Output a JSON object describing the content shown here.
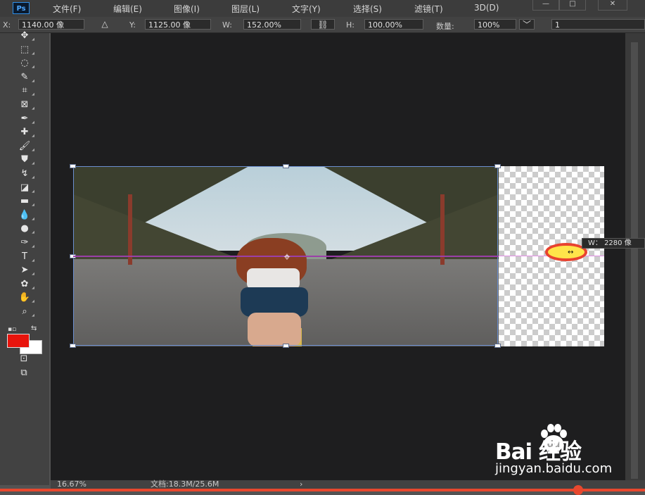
{
  "menubar": {
    "logo": "Ps",
    "items": [
      "文件(F)",
      "编辑(E)",
      "图像(I)",
      "图层(L)",
      "文字(Y)",
      "选择(S)",
      "滤镜(T)",
      "3D(D)"
    ],
    "window_controls": [
      "—",
      "□",
      "✕"
    ]
  },
  "options": {
    "x_label": "X:",
    "x_value": "1140.00 像",
    "y_label": "Y:",
    "y_value": "1125.00 像",
    "w_label": "W:",
    "w_value": "152.00%",
    "h_label": "H:",
    "h_value": "100.00%",
    "opacity_label": "数量:",
    "opacity_value": "100%",
    "last_value": "1",
    "dropdown_glyph": "﹀"
  },
  "tools": [
    {
      "name": "move-tool",
      "glyph": "✥"
    },
    {
      "name": "marquee-tool",
      "glyph": "⬚"
    },
    {
      "name": "lasso-tool",
      "glyph": "◌"
    },
    {
      "name": "quick-select-tool",
      "glyph": "✎"
    },
    {
      "name": "crop-tool",
      "glyph": "⌗"
    },
    {
      "name": "frame-tool",
      "glyph": "⊠"
    },
    {
      "name": "eyedropper-tool",
      "glyph": "✒"
    },
    {
      "name": "healing-tool",
      "glyph": "✚"
    },
    {
      "name": "brush-tool",
      "glyph": "🖌"
    },
    {
      "name": "stamp-tool",
      "glyph": "⛊"
    },
    {
      "name": "history-brush-tool",
      "glyph": "↯"
    },
    {
      "name": "eraser-tool",
      "glyph": "◪"
    },
    {
      "name": "gradient-tool",
      "glyph": "▬"
    },
    {
      "name": "blur-tool",
      "glyph": "💧"
    },
    {
      "name": "dodge-tool",
      "glyph": "●"
    },
    {
      "name": "pen-tool",
      "glyph": "✑"
    },
    {
      "name": "type-tool",
      "glyph": "T"
    },
    {
      "name": "path-select-tool",
      "glyph": "➤"
    },
    {
      "name": "shape-tool",
      "glyph": "✿"
    },
    {
      "name": "hand-tool",
      "glyph": "✋"
    },
    {
      "name": "zoom-tool",
      "glyph": "⌕"
    }
  ],
  "colors": {
    "foreground": "#e8140c",
    "background": "#ffffff",
    "accent": "#e8482e",
    "guide": "#9b3fa8"
  },
  "canvas": {
    "tooltip": "W：  2280 像"
  },
  "status": {
    "zoom": "16.67%",
    "doc": "文档:18.3M/25.6M",
    "arrow": "›"
  },
  "watermark": {
    "logo": "Bai  经验",
    "url": "jingyan.baidu.com"
  }
}
